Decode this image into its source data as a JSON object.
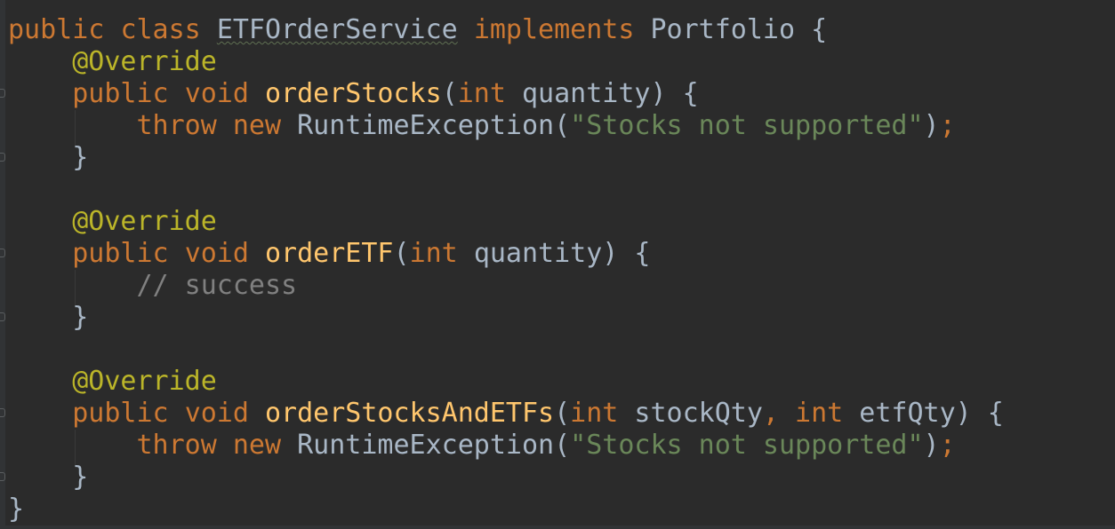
{
  "editor": {
    "lines": [
      {
        "id": "l1",
        "tokens": [
          {
            "t": "public ",
            "c": "kw"
          },
          {
            "t": "class ",
            "c": "kw"
          },
          {
            "t": "ETFOrderService",
            "c": "cls-underline"
          },
          {
            "t": " ",
            "c": "plain"
          },
          {
            "t": "implements ",
            "c": "kw"
          },
          {
            "t": "Portfolio {",
            "c": "plain"
          }
        ]
      },
      {
        "id": "l2",
        "tokens": [
          {
            "t": "    ",
            "c": "plain"
          },
          {
            "t": "@Override",
            "c": "ann"
          }
        ]
      },
      {
        "id": "l3",
        "tokens": [
          {
            "t": "    ",
            "c": "plain"
          },
          {
            "t": "public ",
            "c": "kw"
          },
          {
            "t": "void ",
            "c": "kw"
          },
          {
            "t": "orderStocks",
            "c": "fn"
          },
          {
            "t": "(",
            "c": "plain"
          },
          {
            "t": "int ",
            "c": "kw"
          },
          {
            "t": "quantity) {",
            "c": "plain"
          }
        ]
      },
      {
        "id": "l4",
        "tokens": [
          {
            "t": "        ",
            "c": "plain"
          },
          {
            "t": "throw ",
            "c": "kw"
          },
          {
            "t": "new ",
            "c": "kw"
          },
          {
            "t": "RuntimeException(",
            "c": "plain"
          },
          {
            "t": "\"Stocks not supported\"",
            "c": "str"
          },
          {
            "t": ")",
            "c": "plain"
          },
          {
            "t": ";",
            "c": "kw"
          }
        ]
      },
      {
        "id": "l5",
        "tokens": [
          {
            "t": "    }",
            "c": "plain"
          }
        ]
      },
      {
        "id": "l6",
        "tokens": []
      },
      {
        "id": "l7",
        "tokens": [
          {
            "t": "    ",
            "c": "plain"
          },
          {
            "t": "@Override",
            "c": "ann"
          }
        ]
      },
      {
        "id": "l8",
        "tokens": [
          {
            "t": "    ",
            "c": "plain"
          },
          {
            "t": "public ",
            "c": "kw"
          },
          {
            "t": "void ",
            "c": "kw"
          },
          {
            "t": "orderETF",
            "c": "fn"
          },
          {
            "t": "(",
            "c": "plain"
          },
          {
            "t": "int ",
            "c": "kw"
          },
          {
            "t": "quantity) {",
            "c": "plain"
          }
        ]
      },
      {
        "id": "l9",
        "tokens": [
          {
            "t": "        ",
            "c": "plain"
          },
          {
            "t": "// success",
            "c": "cmt"
          }
        ]
      },
      {
        "id": "l10",
        "tokens": [
          {
            "t": "    }",
            "c": "plain"
          }
        ]
      },
      {
        "id": "l11",
        "tokens": []
      },
      {
        "id": "l12",
        "tokens": [
          {
            "t": "    ",
            "c": "plain"
          },
          {
            "t": "@Override",
            "c": "ann"
          }
        ]
      },
      {
        "id": "l13",
        "tokens": [
          {
            "t": "    ",
            "c": "plain"
          },
          {
            "t": "public ",
            "c": "kw"
          },
          {
            "t": "void ",
            "c": "kw"
          },
          {
            "t": "orderStocksAndETFs",
            "c": "fn"
          },
          {
            "t": "(",
            "c": "plain"
          },
          {
            "t": "int ",
            "c": "kw"
          },
          {
            "t": "stockQty",
            "c": "plain"
          },
          {
            "t": ", ",
            "c": "kw"
          },
          {
            "t": "int ",
            "c": "kw"
          },
          {
            "t": "etfQty) {",
            "c": "plain"
          }
        ]
      },
      {
        "id": "l14",
        "tokens": [
          {
            "t": "        ",
            "c": "plain"
          },
          {
            "t": "throw ",
            "c": "kw"
          },
          {
            "t": "new ",
            "c": "kw"
          },
          {
            "t": "RuntimeException(",
            "c": "plain"
          },
          {
            "t": "\"Stocks not supported\"",
            "c": "str"
          },
          {
            "t": ")",
            "c": "plain"
          },
          {
            "t": ";",
            "c": "kw"
          }
        ]
      },
      {
        "id": "l15",
        "tokens": [
          {
            "t": "    }",
            "c": "plain"
          }
        ]
      },
      {
        "id": "l16",
        "tokens": [
          {
            "t": "}",
            "c": "plain"
          }
        ]
      }
    ]
  },
  "colors": {
    "background": "#2b2b2b",
    "keyword": "#cc7832",
    "annotation": "#bbb529",
    "method": "#ffc66d",
    "string": "#6a8759",
    "comment": "#808080",
    "text": "#a9b7c6"
  }
}
